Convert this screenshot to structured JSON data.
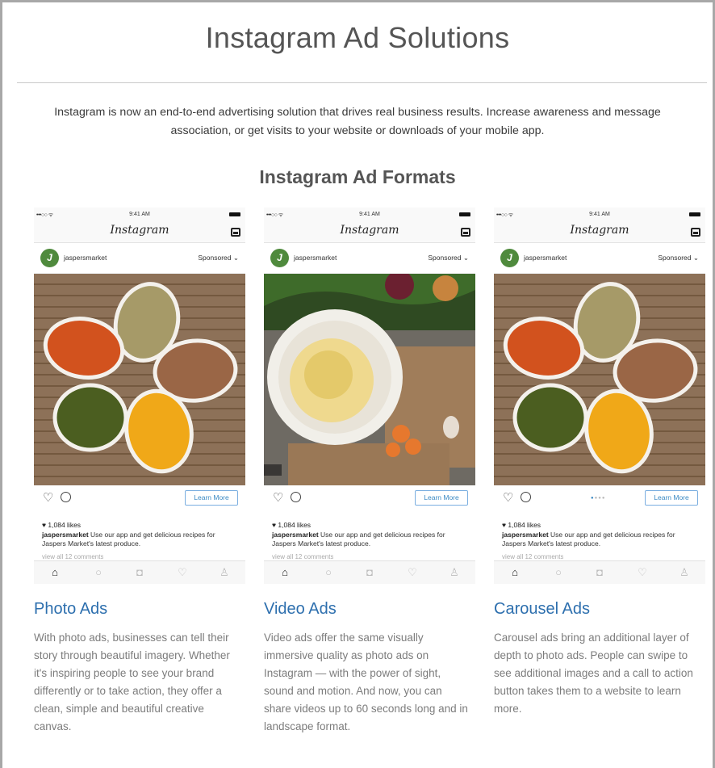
{
  "page": {
    "title": "Instagram Ad Solutions",
    "intro": "Instagram is now an end-to-end advertising solution that drives real business results. Increase awareness and message association, or get visits to your website or downloads of your mobile app.",
    "subtitle": "Instagram Ad Formats"
  },
  "phone": {
    "signal": "•••○○ ᯤ",
    "time": "9:41 AM",
    "logo": "Instagram",
    "username": "jaspersmarket",
    "sponsored": "Sponsored ⌄",
    "learn_more": "Learn More",
    "likes": "♥ 1,084 likes",
    "caption_user": "jaspersmarket",
    "caption_text": " Use our app and get delicious recipes for Jaspers Market's latest produce.",
    "comments": "view all 12 comments",
    "carousel_dots": "●●●●"
  },
  "formats": [
    {
      "title": "Photo Ads",
      "description": "With photo ads, businesses can tell their story through beautiful imagery. Whether it's inspiring people to see your brand differently or to take action, they offer a clean, simple and beautiful creative canvas."
    },
    {
      "title": "Video Ads",
      "description": "Video ads offer the same visually immersive quality as photo ads on Instagram — with the power of sight, sound and motion. And now, you can share videos up to 60 seconds long and in landscape format."
    },
    {
      "title": "Carousel Ads",
      "description": "Carousel ads bring an additional layer of depth to photo ads. People can swipe to see additional images and a call to action button takes them to a website to learn more."
    }
  ],
  "colors": {
    "accent": "#2d6fae",
    "learn_more": "#3b8ac4",
    "wood": "#8b6f54"
  }
}
